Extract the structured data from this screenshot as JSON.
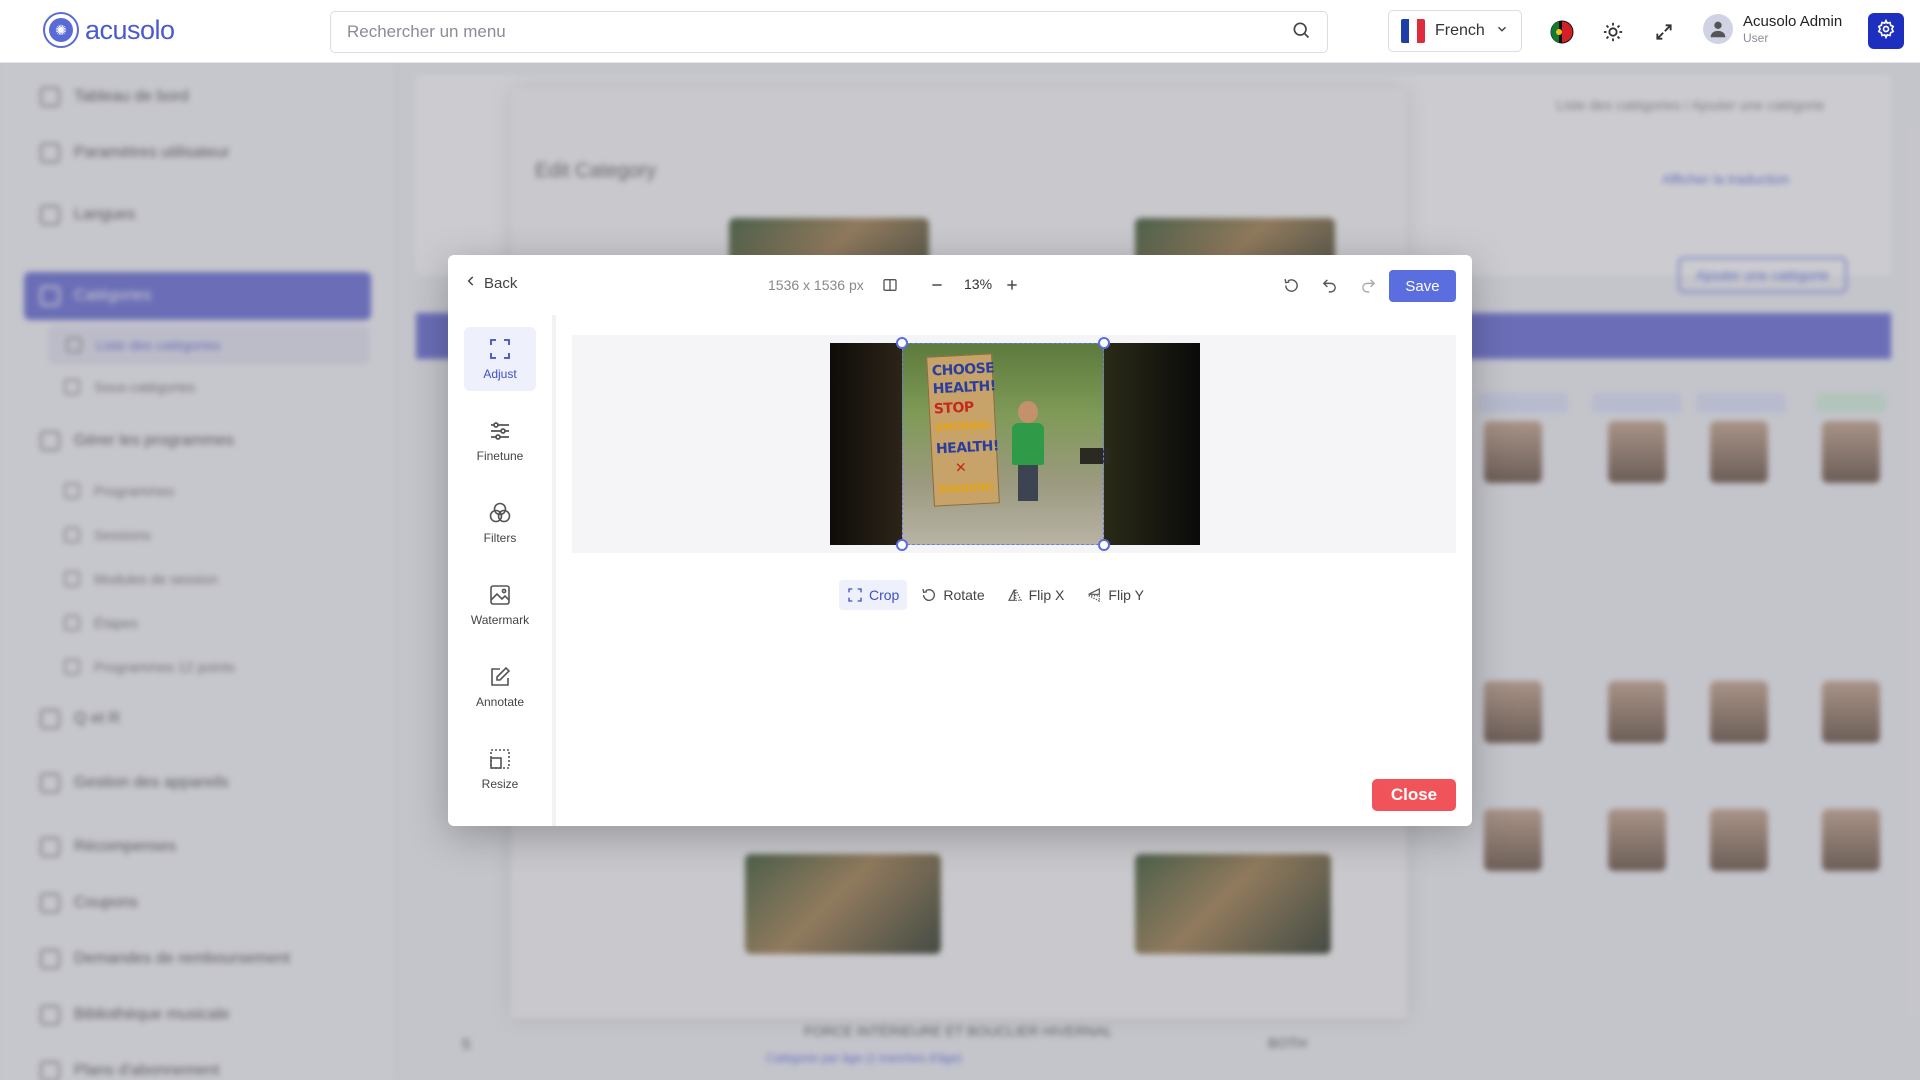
{
  "app": {
    "logo_text": "acusolo"
  },
  "topbar": {
    "search_placeholder": "Rechercher un menu",
    "language": "French",
    "user_name": "Acusolo Admin",
    "user_role": "User"
  },
  "sidebar": {
    "items": [
      {
        "label": "Tableau de bord"
      },
      {
        "label": "Paramètres utilisateur"
      },
      {
        "label": "Langues"
      },
      {
        "label": "Catégories"
      },
      {
        "label": "Liste des catégories"
      },
      {
        "label": "Sous-catégories"
      },
      {
        "label": "Gérer les programmes"
      },
      {
        "label": "Programmes"
      },
      {
        "label": "Sessions"
      },
      {
        "label": "Modules de session"
      },
      {
        "label": "Étapes"
      },
      {
        "label": "Programmes 12 points"
      },
      {
        "label": "Q et R"
      },
      {
        "label": "Gestion des appareils"
      },
      {
        "label": "Récompenses"
      },
      {
        "label": "Coupons"
      },
      {
        "label": "Demandes de remboursement"
      },
      {
        "label": "Bibliothèque musicale"
      },
      {
        "label": "Plans d'abonnement"
      }
    ]
  },
  "background": {
    "page_title": "Edit Category",
    "breadcrumb": "Liste des catégories / Ajouter une catégorie",
    "show_translation": "Afficher la traduction",
    "add_category": "Ajouter une catégorie",
    "row_title": "FORCE INTÉRIEURE ET BOUCLIER HIVERNAL",
    "row_subtitle": "Catégorie par âge (1 tranches d'âge)",
    "row_type": "BOTH",
    "row_num": "5"
  },
  "editor": {
    "back_label": "Back",
    "dimensions": "1536 x 1536 px",
    "zoom": "13%",
    "save_label": "Save",
    "close_label": "Close",
    "tools": [
      {
        "label": "Adjust",
        "icon": "adjust-icon",
        "active": true
      },
      {
        "label": "Finetune",
        "icon": "finetune-icon",
        "active": false
      },
      {
        "label": "Filters",
        "icon": "filters-icon",
        "active": false
      },
      {
        "label": "Watermark",
        "icon": "watermark-icon",
        "active": false
      },
      {
        "label": "Annotate",
        "icon": "annotate-icon",
        "active": false
      },
      {
        "label": "Resize",
        "icon": "resize-icon",
        "active": false
      }
    ],
    "subtools": [
      {
        "label": "Crop",
        "icon": "crop-icon",
        "active": true
      },
      {
        "label": "Rotate",
        "icon": "rotate-icon",
        "active": false
      },
      {
        "label": "Flip X",
        "icon": "flip-x-icon",
        "active": false
      },
      {
        "label": "Flip Y",
        "icon": "flip-y-icon",
        "active": false
      }
    ],
    "sign_words": [
      "CHOOSE",
      "HEALTH!",
      "STOP",
      "SMOKING",
      "HEALTH!",
      "✕",
      "SMOKING"
    ]
  },
  "colors": {
    "accent": "#5b6ee0",
    "sidebar_active": "#6a6fd8",
    "close": "#f0545a",
    "settings_button": "#1c2fbf"
  }
}
